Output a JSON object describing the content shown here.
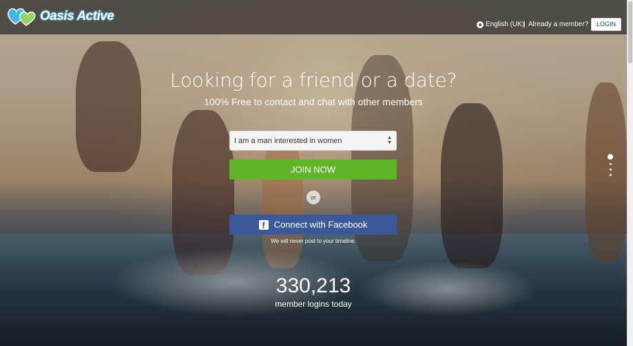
{
  "header": {
    "brand": "Oasis Active",
    "language": "English (UK)",
    "separator": "|",
    "already_member": "Already a member?",
    "login_label": "LOGIN"
  },
  "hero": {
    "headline": "Looking for a friend or a date?",
    "subheadline": "100% Free to contact and chat with other members"
  },
  "signup": {
    "select_value": "I am a man interested in women",
    "join_label": "JOIN NOW",
    "or_label": "or",
    "facebook_label": "Connect with Facebook",
    "facebook_note": "We will never post to your timeline."
  },
  "stats": {
    "count": "330,213",
    "label": "member logins today"
  },
  "icons": {
    "logo": "hearts-logo-icon",
    "language": "globe-icon",
    "facebook": "facebook-icon",
    "select": "updown-arrows-icon"
  },
  "colors": {
    "join": "#5fb52a",
    "facebook": "#3b5998",
    "logo_glow": "#3fb8e6"
  },
  "slider": {
    "count": 4,
    "active_index": 0
  }
}
